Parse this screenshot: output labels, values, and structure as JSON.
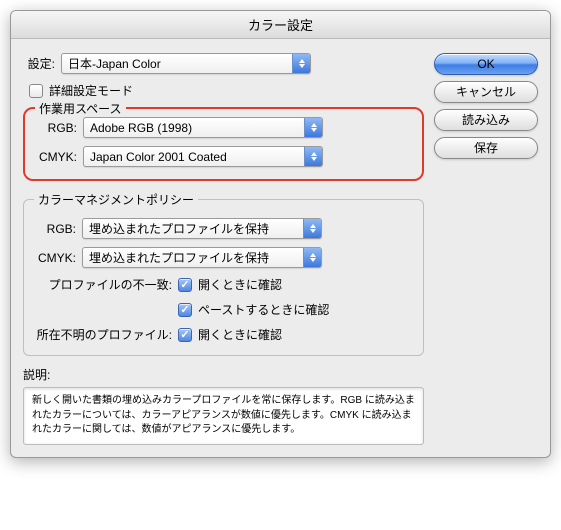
{
  "title": "カラー設定",
  "settings_label": "設定:",
  "settings_value": "日本-Japan Color",
  "advanced_label": "詳細設定モード",
  "workspace": {
    "legend": "作業用スペース",
    "rgb_label": "RGB:",
    "rgb_value": "Adobe RGB (1998)",
    "cmyk_label": "CMYK:",
    "cmyk_value": "Japan Color 2001 Coated"
  },
  "policy": {
    "legend": "カラーマネジメントポリシー",
    "rgb_label": "RGB:",
    "rgb_value": "埋め込まれたプロファイルを保持",
    "cmyk_label": "CMYK:",
    "cmyk_value": "埋め込まれたプロファイルを保持",
    "mismatch_label": "プロファイルの不一致:",
    "mismatch_open": "開くときに確認",
    "mismatch_paste": "ペーストするときに確認",
    "missing_label": "所在不明のプロファイル:",
    "missing_open": "開くときに確認"
  },
  "description": {
    "label": "説明:",
    "text": "新しく開いた書類の埋め込みカラープロファイルを常に保存します。RGB に読み込まれたカラーについては、カラーアピアランスが数値に優先します。CMYK に読み込まれたカラーに関しては、数値がアピアランスに優先します。"
  },
  "buttons": {
    "ok": "OK",
    "cancel": "キャンセル",
    "load": "読み込み",
    "save": "保存"
  }
}
